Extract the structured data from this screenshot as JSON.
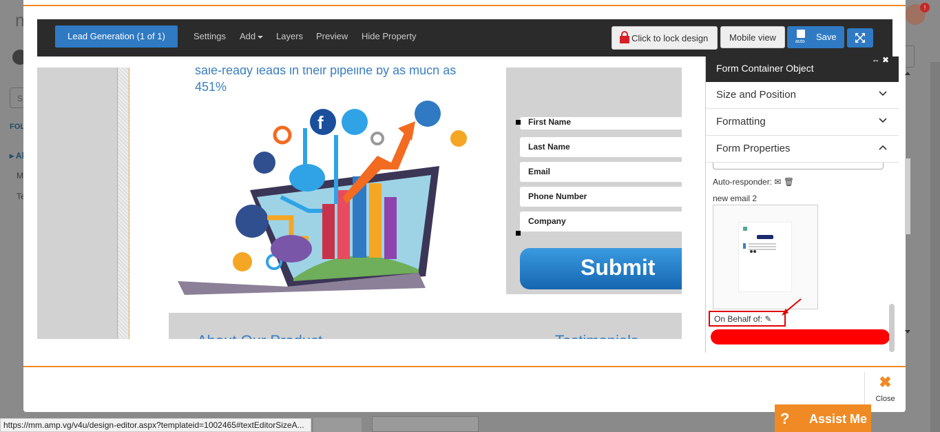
{
  "toolbar": {
    "lead_generation": "Lead Generation  (1 of 1)",
    "settings": "Settings",
    "add": "Add",
    "layers": "Layers",
    "preview": "Preview",
    "hide_property": "Hide Property",
    "lock_design": "Click to lock design",
    "mobile_view": "Mobile view",
    "save": "Save",
    "save_auto": "auto"
  },
  "canvas": {
    "hero_text": "sale-ready leads in their pipeline by as much as 451%",
    "fields": [
      "First Name",
      "Last Name",
      "Email",
      "Phone Number",
      "Company"
    ],
    "submit": "Submit",
    "lower_links": [
      "About Our Product",
      "Testimonials"
    ]
  },
  "props": {
    "title": "Form Container Object",
    "sections": [
      "Size and Position",
      "Formatting",
      "Form Properties"
    ],
    "auto_responder_label": "Auto-responder:",
    "email_name": "new email 2",
    "on_behalf_of": "On Behalf of:"
  },
  "close_label": "Close",
  "assist_label": "Assist Me",
  "status_url": "https://mm.amp.vg/v4u/design-editor.aspx?templateid=1002465#textEditorSizeA...",
  "colors": {
    "accent_orange": "#f08a24",
    "primary_blue": "#2f7ac3",
    "toolbar_dark": "#2b2b2b",
    "redaction_red": "#ff0000"
  }
}
